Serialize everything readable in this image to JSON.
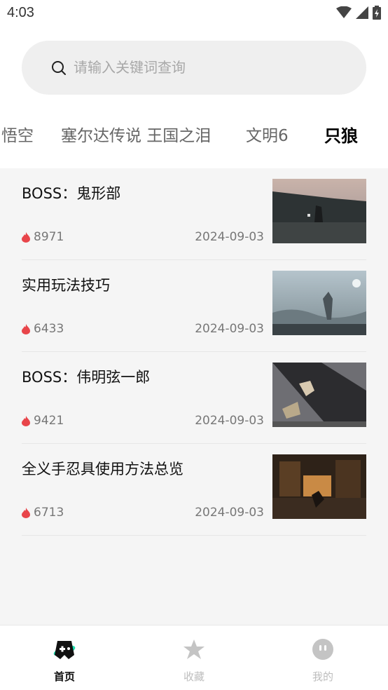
{
  "status": {
    "time": "4:03"
  },
  "search": {
    "placeholder": "请输入关键词查询"
  },
  "tabs": [
    {
      "label": "悟空"
    },
    {
      "label": "塞尔达传说 王国之泪"
    },
    {
      "label": "文明6"
    },
    {
      "label": "只狼",
      "active": true
    }
  ],
  "articles": [
    {
      "title": "BOSS：鬼形部",
      "views": "8971",
      "date": "2024-09-03"
    },
    {
      "title": "实用玩法技巧",
      "views": "6433",
      "date": "2024-09-03"
    },
    {
      "title": "BOSS：伟明弦一郎",
      "views": "9421",
      "date": "2024-09-03"
    },
    {
      "title": "全义手忍具使用方法总览",
      "views": "6713",
      "date": "2024-09-03"
    }
  ],
  "nav": [
    {
      "label": "首页",
      "icon": "game-controller-icon",
      "active": true
    },
    {
      "label": "收藏",
      "icon": "star-icon"
    },
    {
      "label": "我的",
      "icon": "profile-face-icon"
    }
  ],
  "colors": {
    "accent": "#1fe0b0",
    "hot": "#e8454a",
    "inactive": "#bdbdbd"
  }
}
